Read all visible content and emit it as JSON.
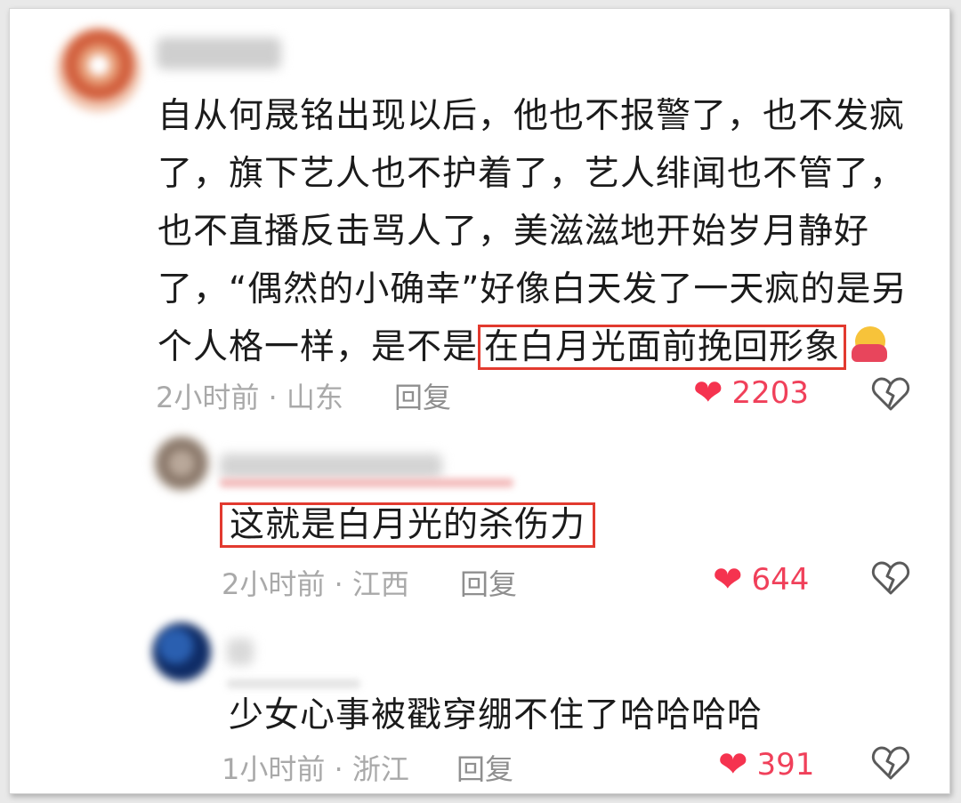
{
  "comments": [
    {
      "text_before_highlight": "自从何晟铭出现以后，他也不报警了，也不发疯了，旗下艺人也不护着了，艺人绯闻也不管了，也不直播反击骂人了，美滋滋地开始岁月静好了，“偶然的小确幸”好像白天发了一天疯的是另个人格一样，是不是",
      "lines": [
        "自从何晟铭出现以后，他也不报警了，也不发疯",
        "了，旗下艺人也不护着了，艺人绯闻也不管了，",
        "也不直播反击骂人了，美滋滋地开始岁月静好",
        "了，“偶然的小确幸”好像白天发了一天疯的是另",
        "个人格一样，是不是"
      ],
      "highlight": "在白月光面前挽回形象",
      "emoji": "hugging-face-icon",
      "meta": "2小时前 · 山东",
      "reply_label": "回复",
      "likes": "2203"
    },
    {
      "text": "这就是白月光的杀伤力",
      "meta": "2小时前 · 江西",
      "reply_label": "回复",
      "likes": "644"
    },
    {
      "text": "少女心事被戳穿绷不住了哈哈哈哈",
      "meta": "1小时前 · 浙江",
      "reply_label": "回复",
      "likes": "391"
    }
  ],
  "colors": {
    "highlight_border": "#e23a2f",
    "like_heart": "#f5334f",
    "like_count": "#f0405a",
    "meta_text": "#a9a9a9"
  }
}
